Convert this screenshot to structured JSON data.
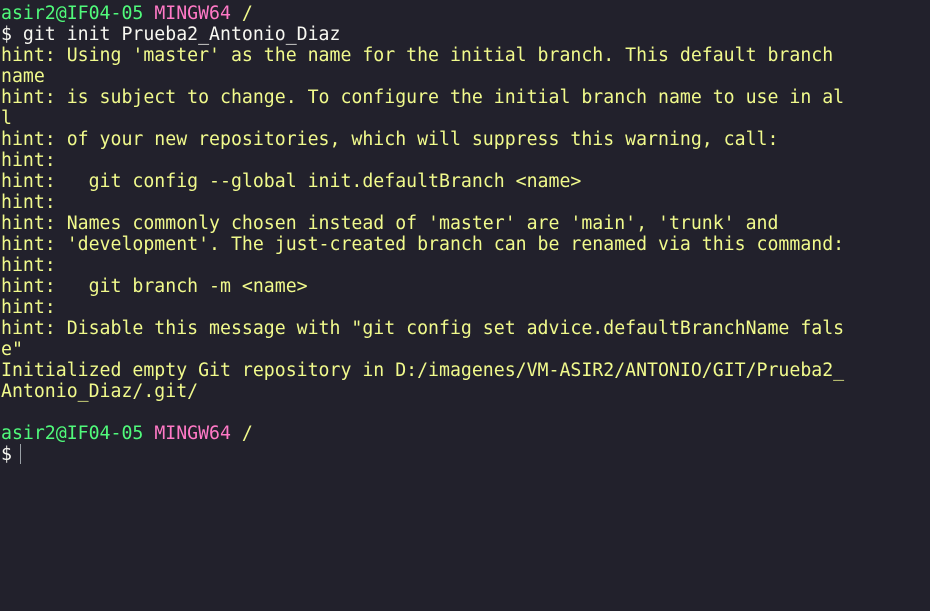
{
  "prompt1": {
    "user_host": "asir2@IF04-05",
    "env": "MINGW64",
    "path": "/"
  },
  "command": "$ git init Prueba2_Antonio_Diaz",
  "output": [
    "hint: Using 'master' as the name for the initial branch. This default branch",
    "name",
    "hint: is subject to change. To configure the initial branch name to use in al",
    "l",
    "hint: of your new repositories, which will suppress this warning, call:",
    "hint:",
    "hint:   git config --global init.defaultBranch <name>",
    "hint:",
    "hint: Names commonly chosen instead of 'master' are 'main', 'trunk' and",
    "hint: 'development'. The just-created branch can be renamed via this command:",
    "hint:",
    "hint:   git branch -m <name>",
    "hint:",
    "hint: Disable this message with \"git config set advice.defaultBranchName fals",
    "e\""
  ],
  "result": [
    "Initialized empty Git repository in D:/imagenes/VM-ASIR2/ANTONIO/GIT/Prueba2_",
    "Antonio_Diaz/.git/"
  ],
  "prompt2": {
    "user_host": "asir2@IF04-05",
    "env": "MINGW64",
    "path": "/",
    "symbol": "$"
  },
  "colors": {
    "background": "#22212c",
    "user_host": "#50fa7b",
    "env": "#ff79c6",
    "path": "#f1fa8c",
    "hint": "#f1fa8c",
    "text": "#f8f8f2"
  }
}
